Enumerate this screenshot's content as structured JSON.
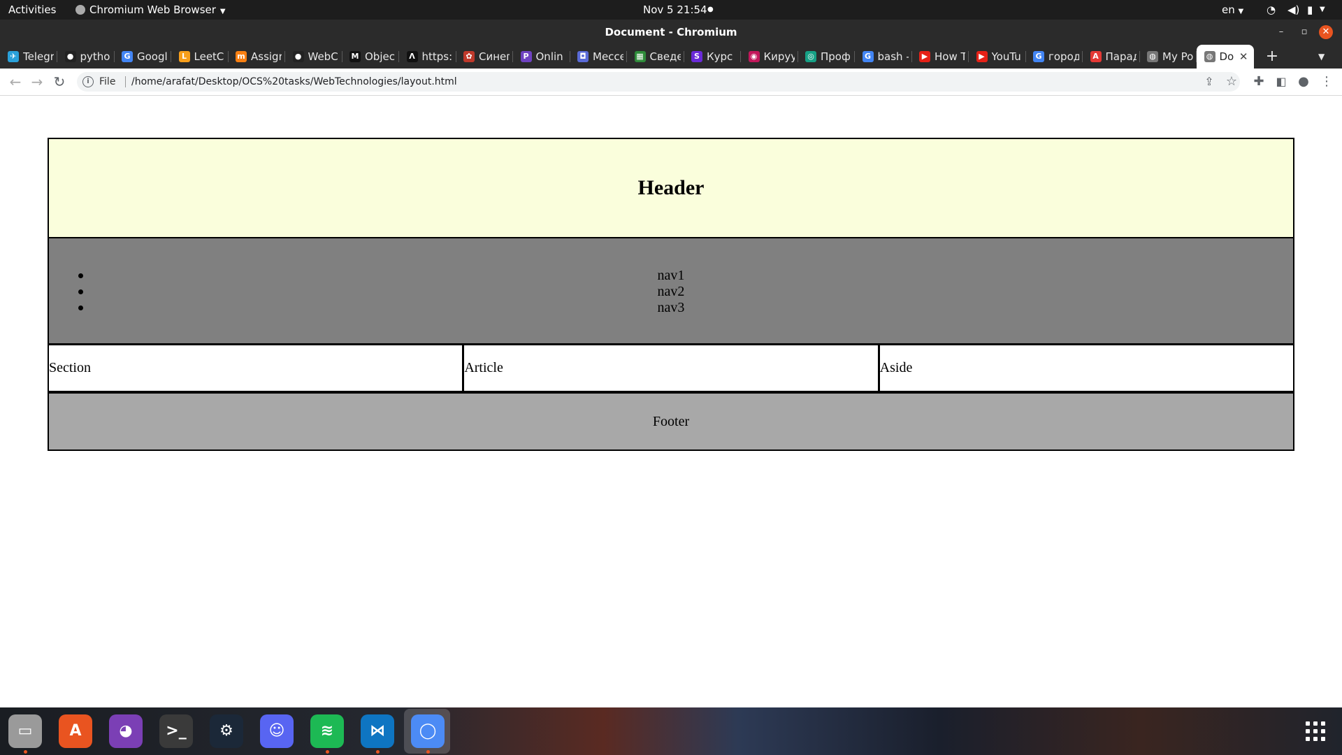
{
  "topbar": {
    "activities": "Activities",
    "app_menu": "Chromium Web Browser",
    "datetime": "Nov 5  21:54",
    "lang": "en"
  },
  "window": {
    "title": "Document - Chromium"
  },
  "tabs": [
    {
      "label": "Telegr",
      "icon": "telegram-icon",
      "color": "#2aa1da",
      "glyph": "✈"
    },
    {
      "label": "pytho",
      "icon": "github-icon",
      "color": "#222222",
      "glyph": "●"
    },
    {
      "label": "Googl",
      "icon": "google-translate-icon",
      "color": "#4285f4",
      "glyph": "G"
    },
    {
      "label": "LeetC",
      "icon": "leetcode-icon",
      "color": "#f89f1b",
      "glyph": "L"
    },
    {
      "label": "Assigr",
      "icon": "moodle-icon",
      "color": "#f98012",
      "glyph": "m"
    },
    {
      "label": "WebC",
      "icon": "github-icon",
      "color": "#222222",
      "glyph": "●"
    },
    {
      "label": "Objec",
      "icon": "medium-icon",
      "color": "#111111",
      "glyph": "M"
    },
    {
      "label": "https:",
      "icon": "a-logo-icon",
      "color": "#111111",
      "glyph": "Λ"
    },
    {
      "label": "Синег",
      "icon": "site-icon",
      "color": "#c0392b",
      "glyph": "✿"
    },
    {
      "label": "Onlin",
      "icon": "p-logo-icon",
      "color": "#6f42c1",
      "glyph": "P"
    },
    {
      "label": "Мессе",
      "icon": "messenger-icon",
      "color": "#5a6bd8",
      "glyph": "◘"
    },
    {
      "label": "Сведе",
      "icon": "sheet-icon",
      "color": "#2e8b3a",
      "glyph": "▦"
    },
    {
      "label": "Курс",
      "icon": "stepik-icon",
      "color": "#6a2ad8",
      "glyph": "S"
    },
    {
      "label": "Кируу",
      "icon": "site-icon",
      "color": "#c2185b",
      "glyph": "◉"
    },
    {
      "label": "Проф",
      "icon": "site-icon",
      "color": "#16a085",
      "glyph": "◎"
    },
    {
      "label": "bash -",
      "icon": "google-icon",
      "color": "#4285f4",
      "glyph": "G"
    },
    {
      "label": "How T",
      "icon": "youtube-icon",
      "color": "#e62117",
      "glyph": "▶"
    },
    {
      "label": "YouTu",
      "icon": "youtube-icon",
      "color": "#e62117",
      "glyph": "▶"
    },
    {
      "label": "город",
      "icon": "google-icon",
      "color": "#4285f4",
      "glyph": "G"
    },
    {
      "label": "Парад",
      "icon": "a-logo-icon",
      "color": "#e53935",
      "glyph": "A"
    },
    {
      "label": "My Po",
      "icon": "globe-icon",
      "color": "#777777",
      "glyph": "◍"
    },
    {
      "label": "Do",
      "icon": "globe-icon",
      "color": "#777777",
      "glyph": "◍",
      "active": true
    }
  ],
  "toolbar": {
    "file_label": "File",
    "url": "/home/arafat/Desktop/OCS%20tasks/WebTechnologies/layout.html"
  },
  "page": {
    "header": "Header",
    "nav": [
      "nav1",
      "nav2",
      "nav3"
    ],
    "section": "Section",
    "article": "Article",
    "aside": "Aside",
    "footer": "Footer"
  },
  "dock": [
    {
      "name": "files-icon",
      "color": "#9a9a9a",
      "glyph": "▭",
      "running": true
    },
    {
      "name": "software-center-icon",
      "color": "#e95420",
      "glyph": "A",
      "running": false
    },
    {
      "name": "color-picker-icon",
      "color": "#7b3fb5",
      "glyph": "◕",
      "running": false
    },
    {
      "name": "terminal-icon",
      "color": "#3a3a3a",
      "glyph": ">_",
      "running": false
    },
    {
      "name": "steam-icon",
      "color": "#1b2838",
      "glyph": "⚙",
      "running": false
    },
    {
      "name": "discord-icon",
      "color": "#5865f2",
      "glyph": "☺",
      "running": false
    },
    {
      "name": "spotify-icon",
      "color": "#1db954",
      "glyph": "≋",
      "running": true
    },
    {
      "name": "vscode-icon",
      "color": "#0e75c2",
      "glyph": "⋈",
      "running": true
    },
    {
      "name": "chromium-icon",
      "color": "#4c8bf5",
      "glyph": "◯",
      "running": true
    }
  ]
}
